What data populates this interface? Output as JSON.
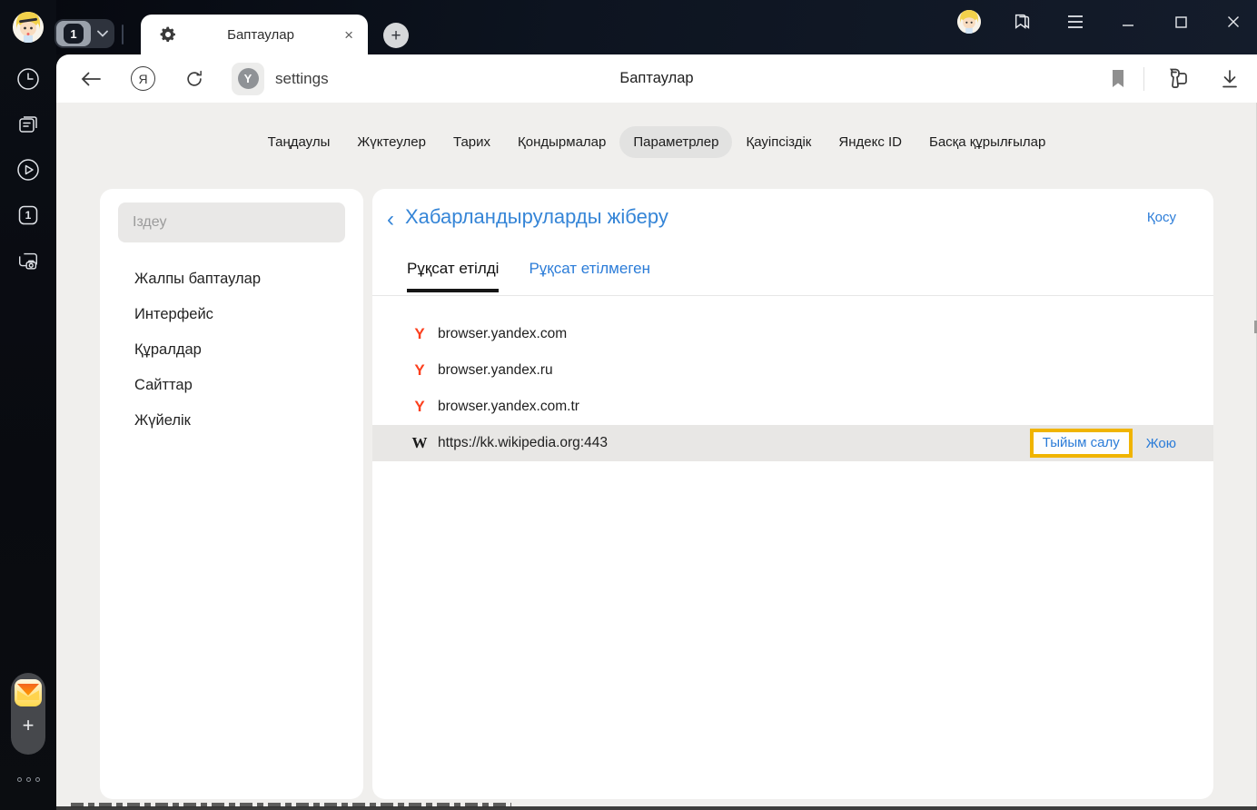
{
  "colors": {
    "accent_blue": "#2b7cd8",
    "header_blue": "#3585d7",
    "yandex_red": "#fc3f1d",
    "highlight_orange": "#f0b400",
    "row_highlight": "#e8e7e5",
    "chrome_dark": "#0d1420"
  },
  "titlebar": {
    "tab_group_count": "1",
    "tab": {
      "title": "Баптаулар",
      "close_glyph": "×"
    },
    "new_tab_glyph": "+"
  },
  "toolbar": {
    "address": "settings",
    "page_title": "Баптаулар",
    "site_badge_letter": "Y",
    "yandex_logo_letter": "Я"
  },
  "nav": {
    "items": [
      {
        "label": "Таңдаулы",
        "active": false
      },
      {
        "label": "Жүктеулер",
        "active": false
      },
      {
        "label": "Тарих",
        "active": false
      },
      {
        "label": "Қондырмалар",
        "active": false
      },
      {
        "label": "Параметрлер",
        "active": true
      },
      {
        "label": "Қауіпсіздік",
        "active": false
      },
      {
        "label": "Яндекс ID",
        "active": false
      },
      {
        "label": "Басқа құрылғылар",
        "active": false
      }
    ]
  },
  "sidebar": {
    "search_placeholder": "Іздеу",
    "items": [
      {
        "label": "Жалпы баптаулар"
      },
      {
        "label": "Интерфейс"
      },
      {
        "label": "Құралдар"
      },
      {
        "label": "Сайттар"
      },
      {
        "label": "Жүйелік"
      }
    ]
  },
  "content": {
    "back_glyph": "‹",
    "title": "Хабарландыруларды жіберу",
    "add_label": "Қосу",
    "tabs": [
      {
        "label": "Рұқсат етілді",
        "active": true
      },
      {
        "label": "Рұқсат етілмеген",
        "active": false
      }
    ],
    "sites": [
      {
        "favicon_letter": "Y",
        "url": "browser.yandex.com"
      },
      {
        "favicon_letter": "Y",
        "url": "browser.yandex.ru"
      },
      {
        "favicon_letter": "Y",
        "url": "browser.yandex.com.tr"
      },
      {
        "favicon_letter": "W",
        "url": "https://kk.wikipedia.org:443",
        "highlighted": true
      }
    ],
    "row_actions": {
      "block_label": "Тыйым салу",
      "delete_label": "Жою"
    }
  },
  "rail": {
    "tabs_count_icon": "1",
    "plus_glyph": "+"
  }
}
